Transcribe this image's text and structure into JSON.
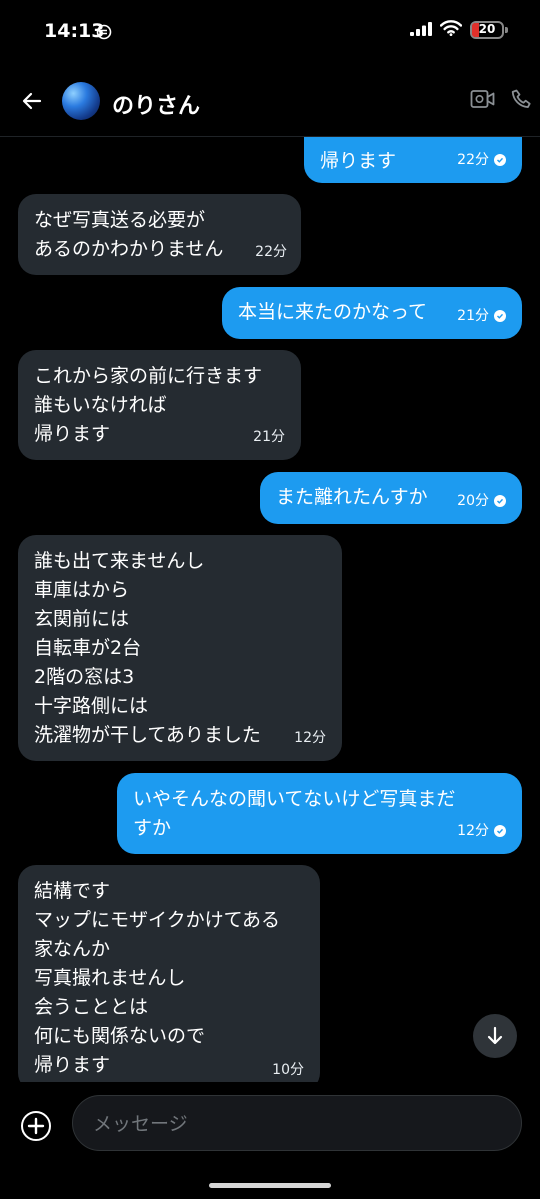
{
  "status": {
    "time": "14:13",
    "battery": "20"
  },
  "header": {
    "name": "のりさん"
  },
  "messages": [
    {
      "dir": "out",
      "text": "帰ります",
      "time": "22分"
    },
    {
      "dir": "in",
      "text": "なぜ写真送る必要が\nあるのかわかりません",
      "time": "22分"
    },
    {
      "dir": "out",
      "text": "本当に来たのかなって",
      "time": "21分"
    },
    {
      "dir": "in",
      "text": "これから家の前に行きます\n誰もいなければ\n帰ります",
      "time": "21分"
    },
    {
      "dir": "out",
      "text": "また離れたんすか",
      "time": "20分"
    },
    {
      "dir": "in",
      "text": "誰も出て来ませんし\n車庫はから\n玄関前には\n自転車が2台\n2階の窓は3\n十字路側には\n洗濯物が干してありました",
      "time": "12分"
    },
    {
      "dir": "out",
      "text": "いやそんなの聞いてないけど写真まだ\nすか",
      "time": "12分"
    },
    {
      "dir": "in",
      "text": "結構です\nマップにモザイクかけてある\n家なんか\n写真撮れませんし\n会うこととは\n何にも関係ないので\n帰ります",
      "time": "10分"
    }
  ],
  "composer": {
    "placeholder": "メッセージ"
  }
}
